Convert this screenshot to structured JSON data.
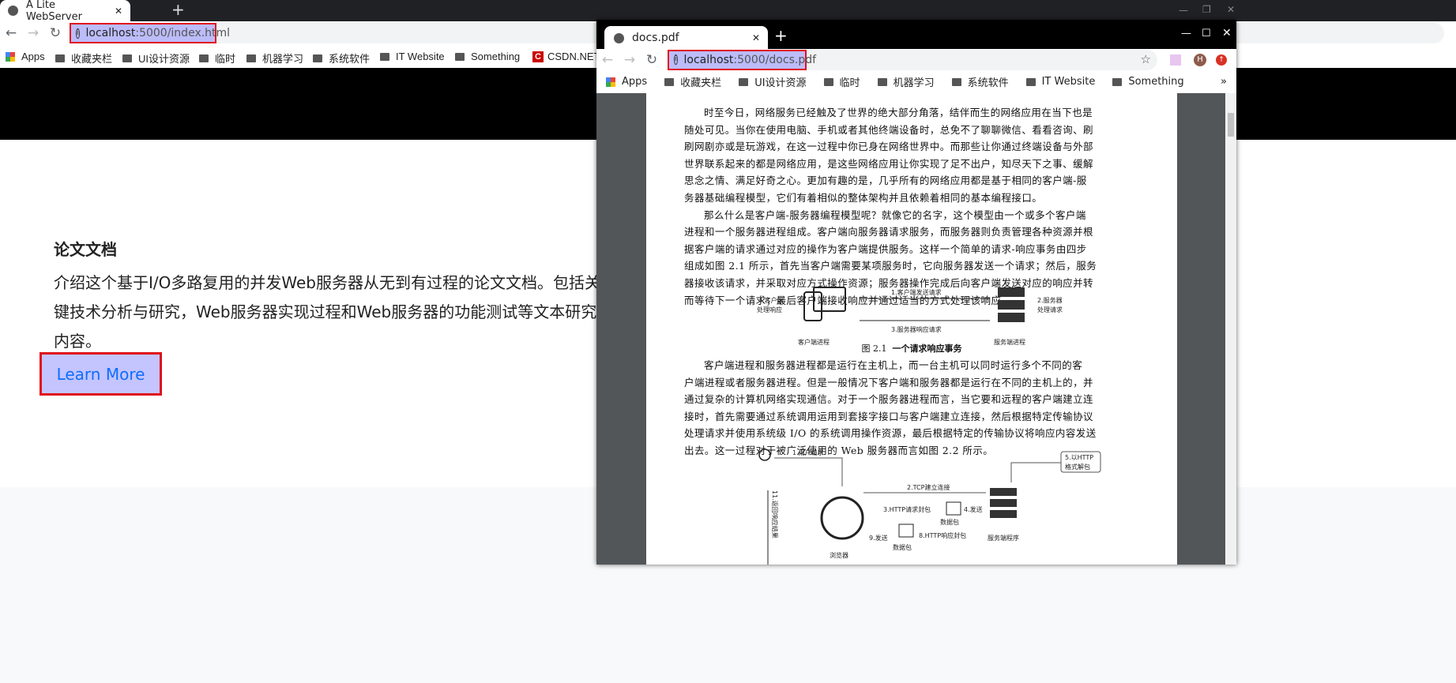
{
  "left_window": {
    "tab_title": "A Lite WebServer",
    "url_host": "localhost",
    "url_path": ":5000/index.html",
    "bookmarks": [
      "Apps",
      "收藏夹栏",
      "UI设计资源",
      "临时",
      "机器学习",
      "系统软件",
      "IT Website",
      "Something",
      "CSDN.NET"
    ],
    "heading": "论文文档",
    "paragraph": "介绍这个基于I/O多路复用的并发Web服务器从无到有过程的论文文档。包括关键技术分析与研究，Web服务器实现过程和Web服务器的功能测试等文本研究内容。",
    "button": "Learn More"
  },
  "right_window": {
    "tab_title": "docs.pdf",
    "url_host": "localhost",
    "url_path": ":5000/docs.pdf",
    "profile_initial": "H",
    "bookmarks": [
      "Apps",
      "收藏夹栏",
      "UI设计资源",
      "临时",
      "机器学习",
      "系统软件",
      "IT Website",
      "Something"
    ],
    "more": "»",
    "pdf": {
      "para1": [
        "时至今日，网络服务已经触及了世界的绝大部分角落，结伴而生的网络应用在当下也是",
        "随处可见。当你在使用电脑、手机或者其他终端设备时，总免不了聊聊微信、看看咨询、刷",
        "刷网剧亦或是玩游戏，在这一过程中你已身在网络世界中。而那些让你通过终端设备与外部",
        "世界联系起来的都是网络应用，是这些网络应用让你实现了足不出户，知尽天下之事、缓解",
        "思念之情、满足好奇之心。更加有趣的是，几乎所有的网络应用都是基于相同的客户端-服",
        "务器基础编程模型，它们有着相似的整体架构并且依赖着相同的基本编程接口。",
        "那么什么是客户端-服务器编程模型呢？就像它的名字，这个模型由一个或多个客户端",
        "进程和一个服务器进程组成。客户端向服务器请求服务，而服务器则负责管理各种资源并根",
        "据客户端的请求通过对应的操作为客户端提供服务。这样一个简单的请求-响应事务由四步",
        "组成如图 2.1 所示，首先当客户端需要某项服务时，它向服务器发送一个请求；然后，服务",
        "器接收该请求，并采取对应方式操作资源；服务器操作完成后向客户端发送对应的响应并转",
        "而等待下一个请求；最后客户端接收响应并通过适当的方式处理该响应。"
      ],
      "fig1": {
        "step1": "1.客户端发送请求",
        "step2a": "2.服务器",
        "step2b": "处理请求",
        "step3": "3.服务器响应请求",
        "step4a": "4.客户端",
        "step4b": "处理响应",
        "client": "客户端进程",
        "server": "服务端进程",
        "caption_num": "图 2.1",
        "caption": "一个请求响应事务"
      },
      "para2": [
        "客户端进程和服务器进程都是运行在主机上，而一台主机可以同时运行多个不同的客",
        "户端进程或者服务器进程。但是一般情况下客户端和服务器都是运行在不同的主机上的，并",
        "通过复杂的计算机网络实现通信。对于一个服务器进程而言，当它要和远程的客户端建立连",
        "接时，首先需要通过系统调用运用到套接字接口与客户端建立连接，然后根据特定传输协议",
        "处理请求并使用系统级 I/O 的系统调用操作资源，最后根据特定的传输协议将响应内容发送",
        "出去。这一过程对于被广泛使用的 Web 服务器而言如图 2.2 所示。"
      ],
      "fig2": {
        "user_req": "1.用户请求",
        "tcp": "2.TCP建立连接",
        "http_pack": "3.HTTP请求封包",
        "send4": "4.发送",
        "packet": "数据包",
        "unpack_a": "5.以HTTP",
        "unpack_b": "格式解包",
        "resp_pack": "8.HTTP响应封包",
        "send9": "9.发送",
        "return11": "11.返回响应结果",
        "browser": "浏览器",
        "server_prog": "服务端程序"
      }
    }
  }
}
